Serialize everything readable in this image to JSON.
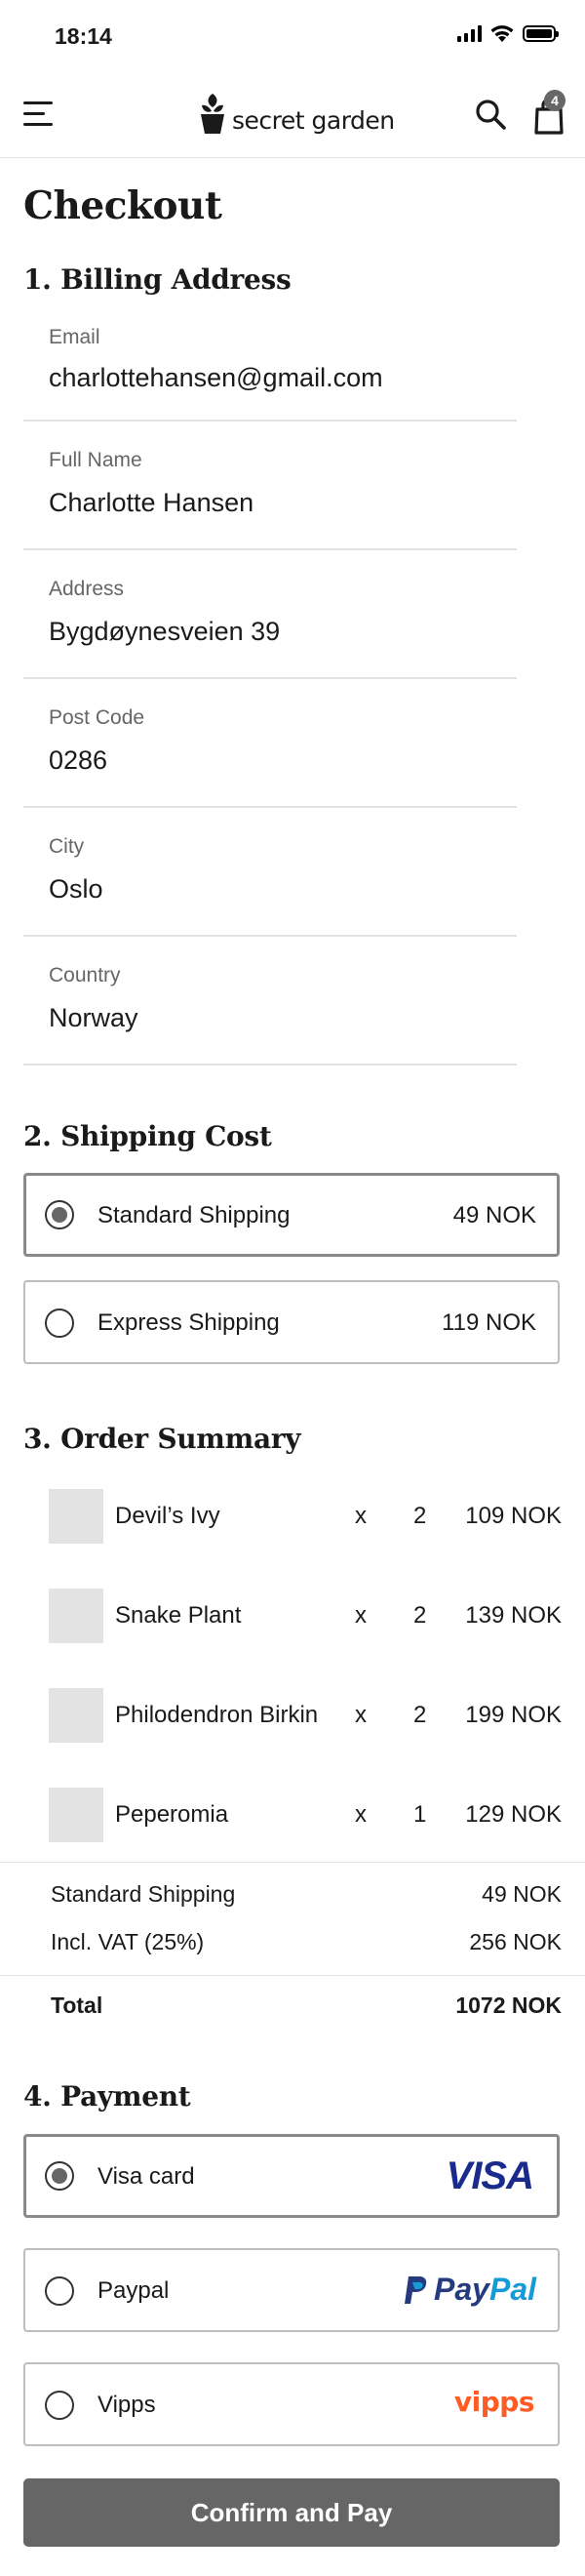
{
  "status_bar": {
    "time": "18:14"
  },
  "header": {
    "brand": "secret garden",
    "cart_count": "4"
  },
  "page_title": "Checkout",
  "billing": {
    "heading": "1. Billing Address",
    "fields": [
      {
        "label": "Email",
        "value": "charlottehansen@gmail.com"
      },
      {
        "label": "Full Name",
        "value": "Charlotte Hansen"
      },
      {
        "label": "Address",
        "value": "Bygdøynesveien 39"
      },
      {
        "label": "Post Code",
        "value": "0286"
      },
      {
        "label": "City",
        "value": "Oslo"
      },
      {
        "label": "Country",
        "value": "Norway"
      }
    ]
  },
  "shipping": {
    "heading": "2. Shipping Cost",
    "options": [
      {
        "label": "Standard Shipping",
        "price": "49 NOK",
        "selected": true
      },
      {
        "label": "Express Shipping",
        "price": "119 NOK",
        "selected": false
      }
    ]
  },
  "order_summary": {
    "heading": "3. Order Summary",
    "items": [
      {
        "name": "Devil’s Ivy",
        "x": "x",
        "qty": "2",
        "price": "109 NOK"
      },
      {
        "name": "Snake Plant",
        "x": "x",
        "qty": "2",
        "price": "139 NOK"
      },
      {
        "name": "Philodendron Birkin",
        "x": "x",
        "qty": "2",
        "price": "199 NOK"
      },
      {
        "name": "Peperomia",
        "x": "x",
        "qty": "1",
        "price": "129 NOK"
      }
    ],
    "shipping_label": "Standard Shipping",
    "shipping_value": "49 NOK",
    "vat_label": "Incl. VAT (25%)",
    "vat_value": "256 NOK",
    "total_label": "Total",
    "total_value": "1072 NOK"
  },
  "payment": {
    "heading": "4. Payment",
    "options": [
      {
        "label": "Visa card",
        "logo_text": "VISA",
        "selected": true
      },
      {
        "label": "Paypal",
        "logo_text_1": "Pay",
        "logo_text_2": "Pal",
        "selected": false
      },
      {
        "label": "Vipps",
        "logo_text": "vipps",
        "selected": false
      }
    ]
  },
  "confirm_label": "Confirm and Pay",
  "colors": {
    "visa_blue": "#1a2b8c",
    "paypal_dark": "#253b80",
    "paypal_light": "#179bd7",
    "vipps_orange": "#ff5b24",
    "button_gray": "#666666"
  }
}
